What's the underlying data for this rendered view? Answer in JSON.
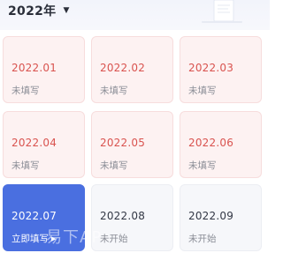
{
  "header": {
    "year_label": "2022年",
    "caret_icon": "caret-down-icon"
  },
  "months": [
    {
      "label": "2022.01",
      "status": "未填写",
      "state": "pending"
    },
    {
      "label": "2022.02",
      "status": "未填写",
      "state": "pending"
    },
    {
      "label": "2022.03",
      "status": "未填写",
      "state": "pending"
    },
    {
      "label": "2022.04",
      "status": "未填写",
      "state": "pending"
    },
    {
      "label": "2022.05",
      "status": "未填写",
      "state": "pending"
    },
    {
      "label": "2022.06",
      "status": "未填写",
      "state": "pending"
    },
    {
      "label": "2022.07",
      "status": "立即填写",
      "state": "current"
    },
    {
      "label": "2022.08",
      "status": "未开始",
      "state": "future"
    },
    {
      "label": "2022.09",
      "status": "未开始",
      "state": "future"
    }
  ],
  "watermark": "易下AP",
  "colors": {
    "pending_text": "#d9534f",
    "pending_bg": "#fdf2f2",
    "current_bg": "#4a6fe0",
    "future_bg": "#f6f7fa"
  }
}
